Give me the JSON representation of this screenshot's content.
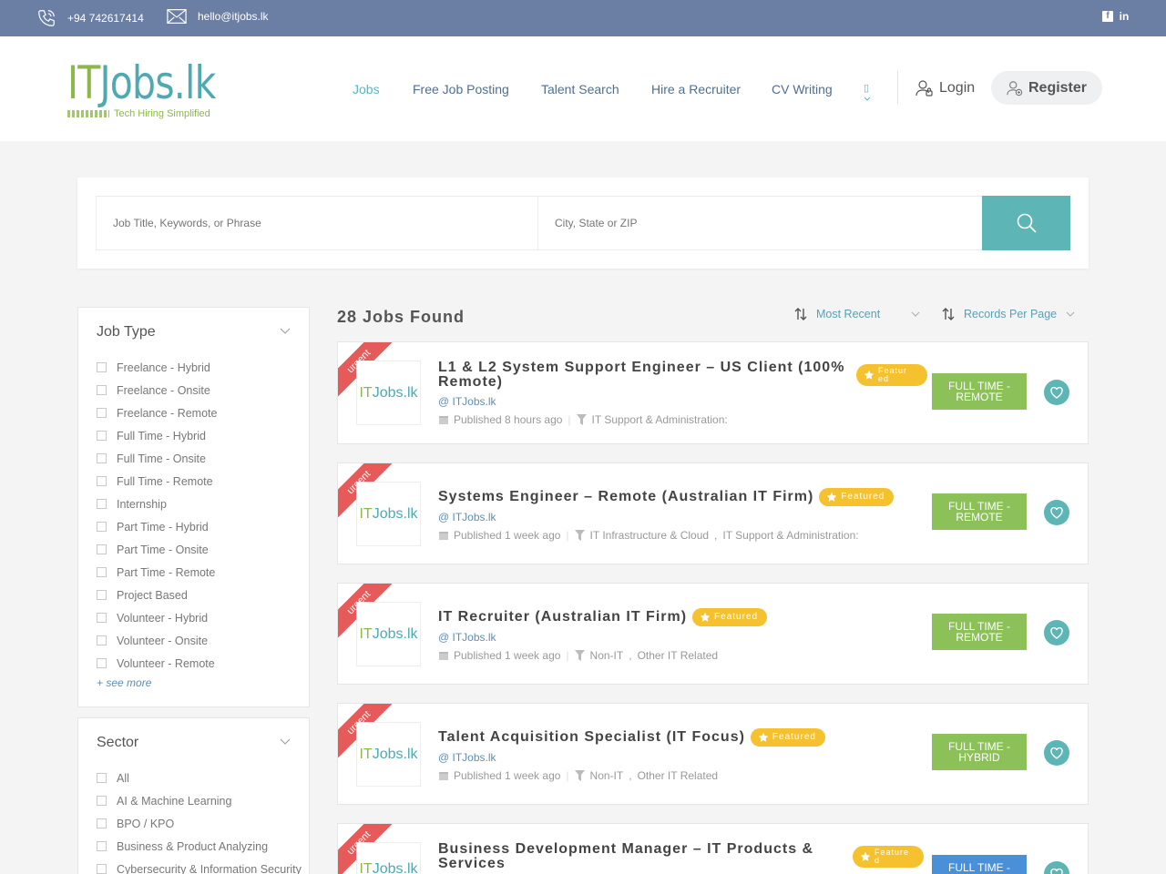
{
  "topbar": {
    "phone": "+94 742617414",
    "email": "hello@itjobs.lk",
    "social": [
      "f",
      "in"
    ]
  },
  "logo": {
    "word1": "IT",
    "word2": "Jobs.lk",
    "tagline": "Tech Hiring Simplified"
  },
  "nav": {
    "items": [
      "Jobs",
      "Free Job Posting",
      "Talent Search",
      "Hire a Recruiter",
      "CV Writing"
    ],
    "login": "Login",
    "register": "Register"
  },
  "search": {
    "keyword_placeholder": "Job Title, Keywords, or Phrase",
    "location_placeholder": "City, State or ZIP"
  },
  "job_type": {
    "title": "Job Type",
    "options": [
      "Freelance - Hybrid",
      "Freelance - Onsite",
      "Freelance - Remote",
      "Full Time - Hybrid",
      "Full Time - Onsite",
      "Full Time - Remote",
      "Internship",
      "Part Time - Hybrid",
      "Part Time - Onsite",
      "Part Time - Remote",
      "Project Based",
      "Volunteer - Hybrid",
      "Volunteer - Onsite",
      "Volunteer - Remote"
    ],
    "see_more": "+ see more"
  },
  "sector": {
    "title": "Sector",
    "options": [
      "All",
      "AI & Machine Learning",
      "BPO / KPO",
      "Business & Product Analyzing",
      "Cybersecurity & Information Security"
    ]
  },
  "results": {
    "count_label": "28 Jobs Found",
    "sort_label": "Most Recent",
    "per_page_label": "Records Per Page"
  },
  "jobs": [
    {
      "badge": "urgent",
      "title_line1": "L1 & L2 System Support Engineer – US Client (100%",
      "title_line2": "Remote)",
      "featured": "Featur ed",
      "company": "@ ITJobs.lk",
      "published": "Published 8 hours ago",
      "category": "IT Support & Administration:",
      "category2": "",
      "type_line1": "FULL TIME -",
      "type_line2": "REMOTE"
    },
    {
      "badge": "urgent",
      "title_line1": "Systems Engineer – Remote (Australian IT Firm)",
      "title_line2": "",
      "featured": "Featured",
      "company": "@ ITJobs.lk",
      "published": "Published 1 week ago",
      "category": "IT Infrastructure & Cloud",
      "category2": "IT Support & Administration:",
      "type_line1": "FULL TIME -",
      "type_line2": "REMOTE"
    },
    {
      "badge": "urgent",
      "title_line1": "IT Recruiter (Australian IT Firm)",
      "title_line2": "",
      "featured": "Featured",
      "company": "@ ITJobs.lk",
      "published": "Published 1 week ago",
      "category": "Non-IT",
      "category2": "Other IT Related",
      "type_line1": "FULL TIME -",
      "type_line2": "REMOTE"
    },
    {
      "badge": "urgent",
      "title_line1": "Talent Acquisition Specialist (IT Focus)",
      "title_line2": "",
      "featured": "Featured",
      "company": "@ ITJobs.lk",
      "published": "Published 1 week ago",
      "category": "Non-IT",
      "category2": "Other IT Related",
      "type_line1": "FULL TIME -",
      "type_line2": "HYBRID"
    },
    {
      "badge": "urgent",
      "title_line1": "Business Development Manager – IT Products &",
      "title_line2": "Services",
      "featured": "Feature d",
      "company": "",
      "published": "",
      "category": "",
      "category2": "",
      "type_line1": "FULL TIME -",
      "type_line2": ""
    }
  ],
  "colors": {
    "topbar": "#6b7fa5",
    "accent": "#5db5b5",
    "green": "#8cb84a",
    "urgent": "#e65a5a",
    "featured": "#f6c12e",
    "type_green": "#8cc15a",
    "type_blue": "#4a90d9"
  }
}
